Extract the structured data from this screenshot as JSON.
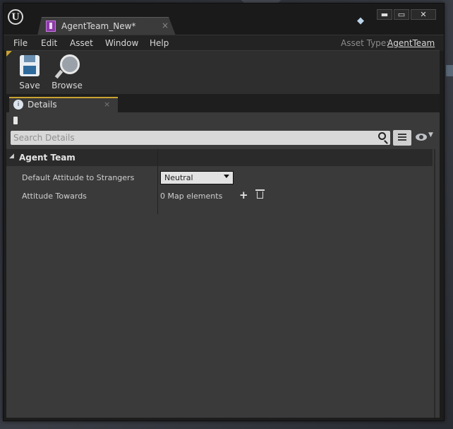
{
  "window": {
    "tab_title": "AgentTeam_New*",
    "close_glyph": "×",
    "controls": {
      "minimize": "▬",
      "maximize": "▭",
      "close": "✕"
    }
  },
  "menu": {
    "items": [
      "File",
      "Edit",
      "Asset",
      "Window",
      "Help"
    ],
    "asset_type_label": "Asset Type:",
    "asset_type_value": "AgentTeam"
  },
  "toolbar": {
    "save_label": "Save",
    "browse_label": "Browse"
  },
  "details_tab": {
    "label": "Details",
    "close_glyph": "×"
  },
  "search": {
    "placeholder": "Search Details",
    "value": ""
  },
  "category": {
    "title": "Agent Team",
    "toggle_glyph": "◢"
  },
  "properties": [
    {
      "label": "Default Attitude to Strangers",
      "value": "Neutral"
    },
    {
      "label": "Attitude Towards",
      "value": "0 Map elements"
    }
  ],
  "icons": {
    "add": "+",
    "eye_dropdown": "▼",
    "help": "◆"
  },
  "colors": {
    "accent": "#c9a331",
    "panel_bg": "#3a3a3a",
    "asset_icon": "#8b3aa6"
  }
}
